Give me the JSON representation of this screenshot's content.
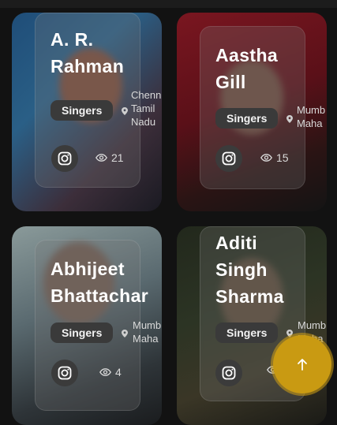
{
  "cards": [
    {
      "name": "A. R.\nRahman",
      "category": "Singers",
      "location": "Chenn\nTamil\nNadu",
      "views": "21"
    },
    {
      "name": "Aastha\nGill",
      "category": "Singers",
      "location": "Mumb\nMaha",
      "views": "15"
    },
    {
      "name": "Abhijeet\nBhattachar",
      "category": "Singers",
      "location": "Mumb\nMaha",
      "views": "4"
    },
    {
      "name": "Aditi\nSingh\nSharma",
      "category": "Singers",
      "location": "Mumb\nMaha",
      "views": ""
    }
  ],
  "icons": {
    "social": "instagram-icon",
    "views": "eye-icon",
    "location": "map-pin-icon",
    "fab": "arrow-up-icon"
  },
  "colors": {
    "accent": "#c99a12",
    "background": "#121212"
  }
}
